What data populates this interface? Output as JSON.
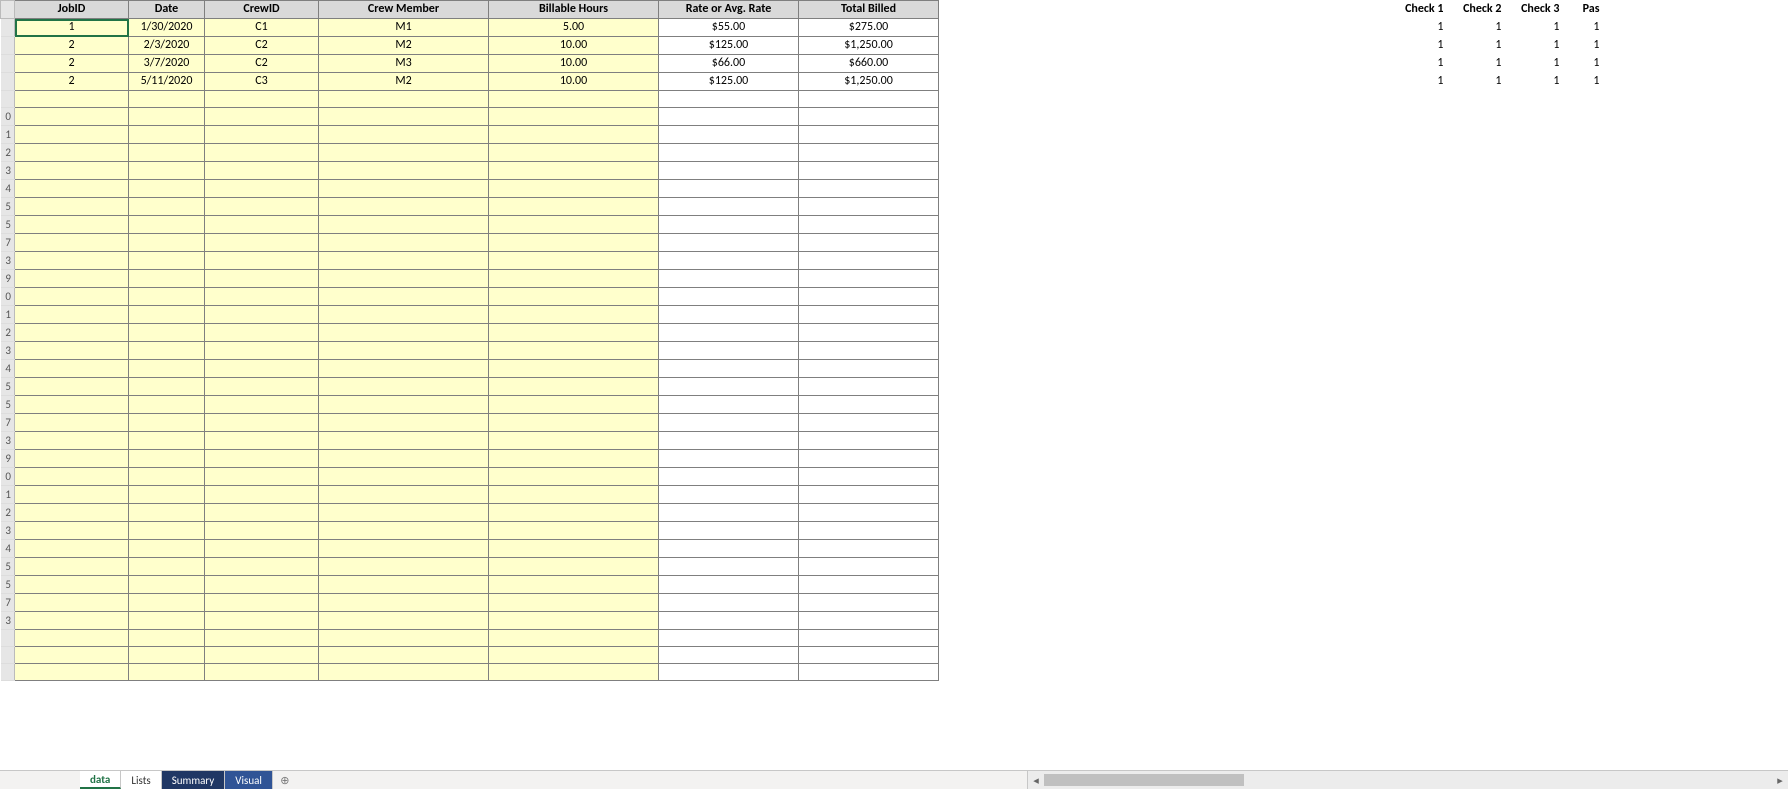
{
  "headers": {
    "jobid": "JobID",
    "date": "Date",
    "crewid": "CrewID",
    "crewmember": "Crew Member",
    "billable": "Billable Hours",
    "rate": "Rate or Avg. Rate",
    "total": "Total Billed",
    "chk1": "Check 1",
    "chk2": "Check 2",
    "chk3": "Check 3",
    "pass": "Pas"
  },
  "rows": [
    {
      "jobid": "1",
      "date": "1/30/2020",
      "crewid": "C1",
      "member": "M1",
      "hours": "5.00",
      "rate": "$55.00",
      "total": "$275.00",
      "c1": "1",
      "c2": "1",
      "c3": "1",
      "p": "1"
    },
    {
      "jobid": "2",
      "date": "2/3/2020",
      "crewid": "C2",
      "member": "M2",
      "hours": "10.00",
      "rate": "$125.00",
      "total": "$1,250.00",
      "c1": "1",
      "c2": "1",
      "c3": "1",
      "p": "1"
    },
    {
      "jobid": "2",
      "date": "3/7/2020",
      "crewid": "C2",
      "member": "M3",
      "hours": "10.00",
      "rate": "$66.00",
      "total": "$660.00",
      "c1": "1",
      "c2": "1",
      "c3": "1",
      "p": "1"
    },
    {
      "jobid": "2",
      "date": "5/11/2020",
      "crewid": "C3",
      "member": "M2",
      "hours": "10.00",
      "rate": "$125.00",
      "total": "$1,250.00",
      "c1": "1",
      "c2": "1",
      "c3": "1",
      "p": "1"
    }
  ],
  "rowheaders": [
    "",
    "",
    "",
    "",
    "",
    "0",
    "1",
    "2",
    "3",
    "4",
    "5",
    "5",
    "7",
    "3",
    "9",
    "0",
    "1",
    "2",
    "3",
    "4",
    "5",
    "5",
    "7",
    "3",
    "9",
    "0",
    "1",
    "2",
    "3",
    "4",
    "5",
    "5",
    "7",
    "3"
  ],
  "blankRows": 33,
  "tabs": {
    "data": "data",
    "lists": "Lists",
    "summary": "Summary",
    "visual": "Visual",
    "add": "⊕"
  },
  "scroll": {
    "left": "◂",
    "right": "▸"
  }
}
